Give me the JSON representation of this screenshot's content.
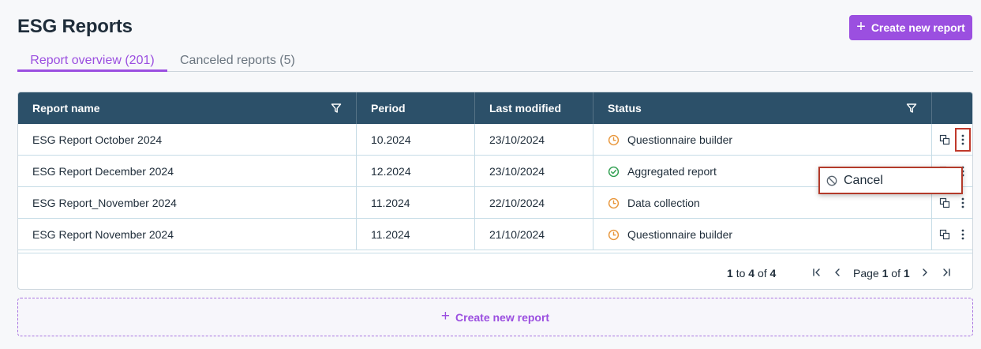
{
  "page": {
    "title": "ESG Reports"
  },
  "header": {
    "create_label": "Create new report",
    "create_icon": "plus-icon"
  },
  "tabs": [
    {
      "label": "Report overview (201)",
      "active": true
    },
    {
      "label": "Canceled reports (5)",
      "active": false
    }
  ],
  "table": {
    "columns": [
      "Report name",
      "Period",
      "Last modified",
      "Status"
    ],
    "rows": [
      {
        "name": "ESG Report October 2024",
        "period": "10.2024",
        "modified": "23/10/2024",
        "status": "Questionnaire builder",
        "status_icon": "clock-icon"
      },
      {
        "name": "ESG Report December 2024",
        "period": "12.2024",
        "modified": "23/10/2024",
        "status": "Aggregated report",
        "status_icon": "check-circle-icon"
      },
      {
        "name": "ESG Report_November 2024",
        "period": "11.2024",
        "modified": "22/10/2024",
        "status": "Data collection",
        "status_icon": "clock-icon"
      },
      {
        "name": "ESG Report November 2024",
        "period": "11.2024",
        "modified": "21/10/2024",
        "status": "Questionnaire builder",
        "status_icon": "clock-icon"
      }
    ]
  },
  "pagination": {
    "from": "1",
    "to_word": "to",
    "to": "4",
    "of_word": "of",
    "total": "4",
    "page_word": "Page",
    "page": "1",
    "page_of_word": "of",
    "pages": "1"
  },
  "dashed_create": {
    "label": "Create new report"
  },
  "context_menu": {
    "cancel_label": "Cancel",
    "cancel_icon": "ban-icon"
  },
  "colors": {
    "accent": "#9b4fe0",
    "header_bg": "#2c5069",
    "pending": "#e8963a",
    "done": "#2e9e4f",
    "highlight": "#c0392b"
  }
}
